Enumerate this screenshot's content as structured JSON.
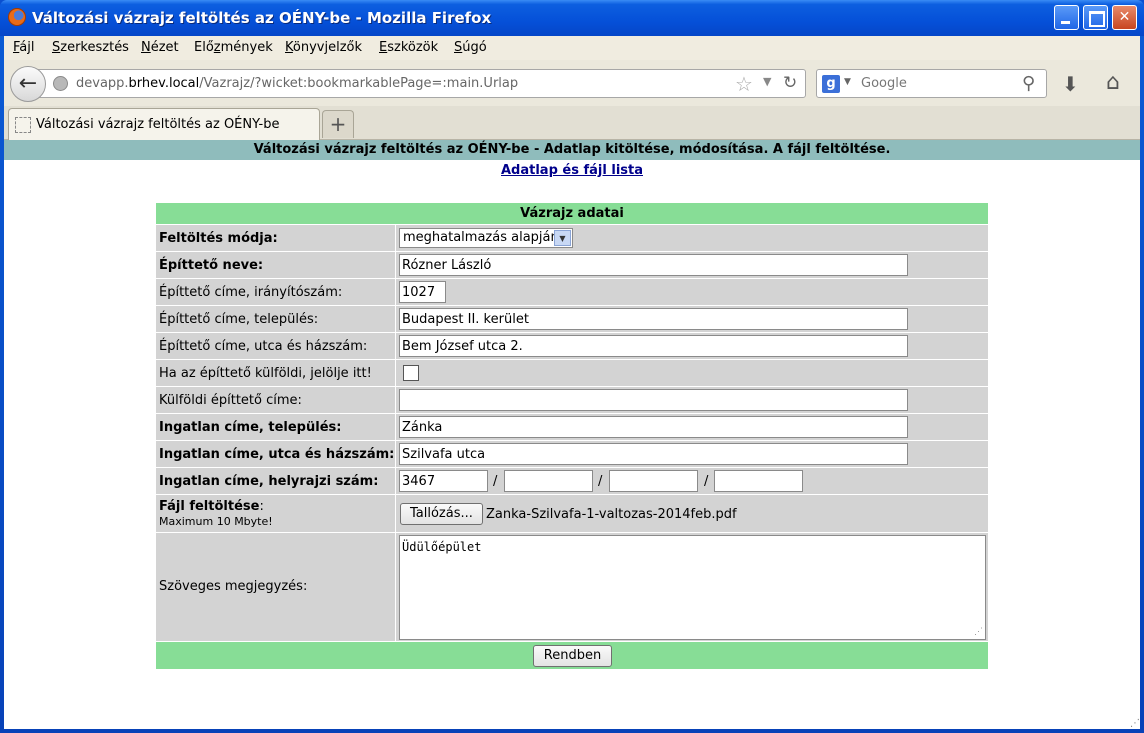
{
  "window": {
    "title": "Változási vázrajz feltöltés az OÉNY-be - Mozilla Firefox"
  },
  "menu": [
    {
      "label_pre": "",
      "label_u": "F",
      "label_post": "ájl"
    },
    {
      "label_pre": "",
      "label_u": "S",
      "label_post": "zerkesztés"
    },
    {
      "label_pre": "",
      "label_u": "N",
      "label_post": "ézet"
    },
    {
      "label_pre": "Elő",
      "label_u": "z",
      "label_post": "mények"
    },
    {
      "label_pre": "",
      "label_u": "K",
      "label_post": "önyvjelzők"
    },
    {
      "label_pre": "",
      "label_u": "E",
      "label_post": "szközök"
    },
    {
      "label_pre": "",
      "label_u": "S",
      "label_post": "úgó"
    }
  ],
  "navbar": {
    "url_prefix": "devapp.",
    "url_host": "brhev.local",
    "url_path": "/Vazrajz/?wicket:bookmarkablePage=:main.Urlap",
    "search_placeholder": "Google",
    "search_engine_letter": "g"
  },
  "tab": {
    "label": "Változási vázrajz feltöltés az OÉNY-be",
    "new_tab_symbol": "+"
  },
  "page": {
    "header": "Változási vázrajz feltöltés az OÉNY-be - Adatlap kitöltése, módosítása. A fájl feltöltése.",
    "link": "Adatlap és fájl lista"
  },
  "form": {
    "title": "Vázrajz adatai",
    "upload_mode_label": "Feltöltés módja:",
    "upload_mode_value": "meghatalmazás alapján",
    "builder_name_label": "Építtető neve:",
    "builder_name_value": "Rózner László",
    "builder_zip_label": "Építtető címe, irányítószám:",
    "builder_zip_value": "1027",
    "builder_city_label": "Építtető címe, település:",
    "builder_city_value": "Budapest II. kerület",
    "builder_street_label": "Építtető címe, utca és házszám:",
    "builder_street_value": "Bem József utca 2.",
    "foreign_label": "Ha az építtető külföldi, jelölje itt!",
    "foreign_checked": false,
    "foreign_address_label": "Külföldi építtető címe:",
    "foreign_address_value": "",
    "property_city_label": "Ingatlan címe, település:",
    "property_city_value": "Zánka",
    "property_street_label": "Ingatlan címe, utca és házszám:",
    "property_street_value": "Szilvafa utca",
    "parcel_label": "Ingatlan címe, helyrajzi szám:",
    "parcel_values": [
      "3467",
      "",
      "",
      ""
    ],
    "slash": "/",
    "file_label": "Fájl feltöltése",
    "file_label_colon": ":",
    "file_max": "Maximum 10 Mbyte!",
    "browse_label": "Tallózás...",
    "file_name": "Zanka-Szilvafa-1-valtozas-2014feb.pdf",
    "note_label": "Szöveges megjegyzés:",
    "note_value": "Üdülőépület",
    "submit_label": "Rendben"
  }
}
